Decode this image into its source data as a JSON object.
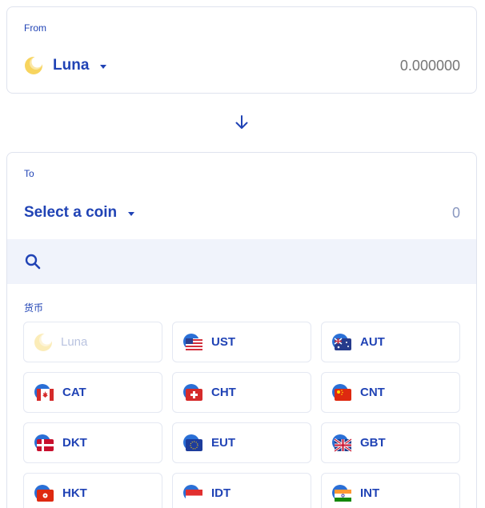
{
  "from": {
    "label": "From",
    "coin": "Luna",
    "amount_placeholder": "0.000000"
  },
  "to": {
    "label": "To",
    "coin": "Select a coin",
    "amount": "0"
  },
  "search": {
    "placeholder": ""
  },
  "section_label": "货币",
  "coins": [
    {
      "label": "Luna",
      "icon": "luna-icon",
      "disabled": true
    },
    {
      "label": "UST",
      "icon": "flag-us-icon"
    },
    {
      "label": "AUT",
      "icon": "flag-au-icon"
    },
    {
      "label": "CAT",
      "icon": "flag-ca-icon"
    },
    {
      "label": "CHT",
      "icon": "flag-ch-icon"
    },
    {
      "label": "CNT",
      "icon": "flag-cn-icon"
    },
    {
      "label": "DKT",
      "icon": "flag-dk-icon"
    },
    {
      "label": "EUT",
      "icon": "flag-eu-icon"
    },
    {
      "label": "GBT",
      "icon": "flag-gb-icon"
    },
    {
      "label": "HKT",
      "icon": "flag-hk-icon"
    },
    {
      "label": "IDT",
      "icon": "flag-id-icon"
    },
    {
      "label": "INT",
      "icon": "flag-in-icon"
    }
  ],
  "colors": {
    "accent": "#2043b5",
    "luna": "#f5d05a",
    "search_bg": "#f0f3fb",
    "border": "#dfe3ee"
  }
}
